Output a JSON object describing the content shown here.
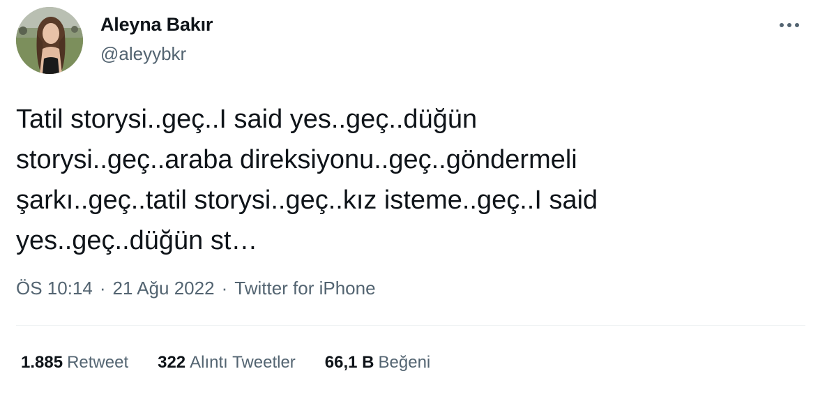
{
  "author": {
    "display_name": "Aleyna Bakır",
    "handle": "@aleyybkr"
  },
  "tweet": {
    "text": "Tatil storysi..geç..I said yes..geç..düğün\nstorysi..geç..araba direksiyonu..geç..göndermeli\nşarkı..geç..tatil storysi..geç..kız isteme..geç..I said\nyes..geç..düğün st…"
  },
  "meta": {
    "time": "ÖS 10:14",
    "date": "21 Ağu 2022",
    "source": "Twitter for iPhone",
    "separator": "·"
  },
  "stats": {
    "retweets": {
      "count": "1.885",
      "label": "Retweet"
    },
    "quotes": {
      "count": "322",
      "label": "Alıntı Tweetler"
    },
    "likes": {
      "count": "66,1 B",
      "label": "Beğeni"
    }
  },
  "icons": {
    "more": "more-horizontal-icon"
  },
  "colors": {
    "primary_text": "#0f1419",
    "secondary_text": "#536471",
    "divider": "#eff3f4"
  }
}
